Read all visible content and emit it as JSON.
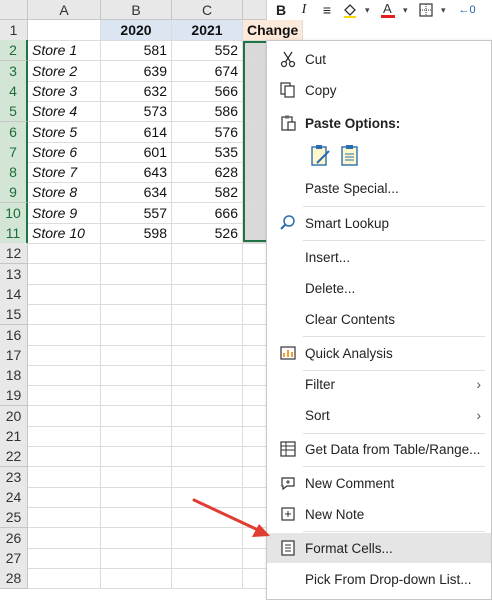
{
  "columns": [
    "A",
    "B",
    "C"
  ],
  "headers": {
    "b": "2020",
    "c": "2021",
    "d": "Change"
  },
  "rows": [
    {
      "store": "Store 1",
      "y2020": "581",
      "y2021": "552"
    },
    {
      "store": "Store 2",
      "y2020": "639",
      "y2021": "674"
    },
    {
      "store": "Store 3",
      "y2020": "632",
      "y2021": "566"
    },
    {
      "store": "Store 4",
      "y2020": "573",
      "y2021": "586"
    },
    {
      "store": "Store 5",
      "y2020": "614",
      "y2021": "576"
    },
    {
      "store": "Store 6",
      "y2020": "601",
      "y2021": "535"
    },
    {
      "store": "Store 7",
      "y2020": "643",
      "y2021": "628"
    },
    {
      "store": "Store 8",
      "y2020": "634",
      "y2021": "582"
    },
    {
      "store": "Store 9",
      "y2020": "557",
      "y2021": "666"
    },
    {
      "store": "Store 10",
      "y2020": "598",
      "y2021": "526"
    }
  ],
  "row_numbers": [
    "1",
    "2",
    "3",
    "4",
    "5",
    "6",
    "7",
    "8",
    "9",
    "10",
    "11",
    "12",
    "13",
    "14",
    "15",
    "16",
    "17",
    "18",
    "19",
    "20",
    "21",
    "22",
    "23",
    "24",
    "25",
    "26",
    "27",
    "28"
  ],
  "toolbar": {
    "bold": "B",
    "italic": "I",
    "align": "≡",
    "fill_icon": "paint-bucket-icon",
    "font_color_icon": "font-color-icon",
    "borders_icon": "borders-icon",
    "decrease_decimal": "←0"
  },
  "menu": {
    "cut": "Cut",
    "copy": "Copy",
    "paste_options": "Paste Options:",
    "paste_special": "Paste Special...",
    "smart_lookup": "Smart Lookup",
    "insert": "Insert...",
    "delete": "Delete...",
    "clear_contents": "Clear Contents",
    "quick_analysis": "Quick Analysis",
    "filter": "Filter",
    "sort": "Sort",
    "get_data": "Get Data from Table/Range...",
    "new_comment": "New Comment",
    "new_note": "New Note",
    "format_cells": "Format Cells...",
    "pick_from_list": "Pick From Drop-down List..."
  },
  "colors": {
    "accent": "#217346",
    "header_blue": "#dce6f2",
    "header_orange": "#fde9d9",
    "arrow": "#e03c31"
  }
}
